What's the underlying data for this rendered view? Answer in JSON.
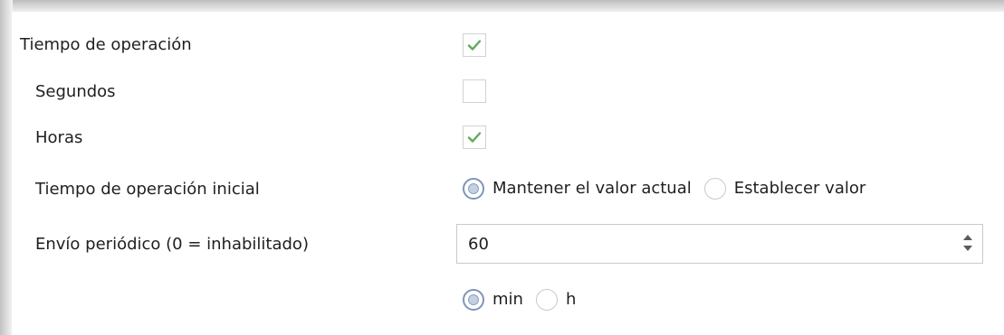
{
  "rows": {
    "operation_time": {
      "label": "Tiempo de operación",
      "checked": true
    },
    "seconds": {
      "label": "Segundos",
      "checked": false
    },
    "hours": {
      "label": "Horas",
      "checked": true
    },
    "initial_time": {
      "label": "Tiempo de operación inicial",
      "options": [
        "Mantener el valor actual",
        "Establecer valor"
      ],
      "selected": "Mantener el valor actual"
    },
    "periodic_send": {
      "label": "Envío periódico (0 = inhabilitado)",
      "value": "60"
    },
    "unit": {
      "options": [
        "min",
        "h"
      ],
      "selected": "min"
    }
  },
  "colors": {
    "check_green": "#5fa85f",
    "radio_selected_border": "#7d95b8",
    "field_border": "#c9c9c9"
  },
  "icons": {
    "check": "checkmark-icon",
    "spin_up": "chevron-up-icon",
    "spin_down": "chevron-down-icon"
  }
}
